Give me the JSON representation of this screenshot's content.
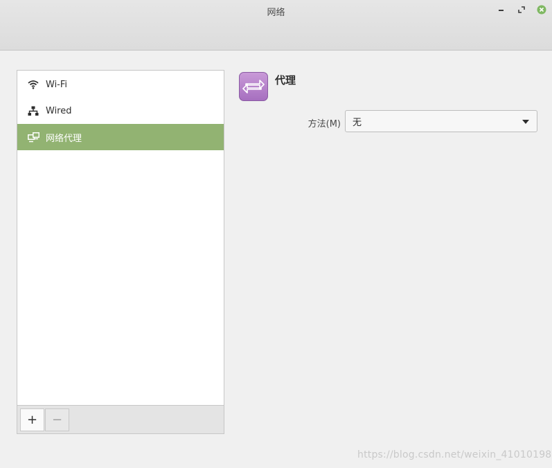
{
  "window": {
    "title": "网络"
  },
  "sidebar": {
    "items": [
      {
        "label": "Wi-Fi",
        "icon": "wifi-icon",
        "selected": false
      },
      {
        "label": "Wired",
        "icon": "wired-network-icon",
        "selected": false
      },
      {
        "label": "网络代理",
        "icon": "network-proxy-icon",
        "selected": true
      }
    ],
    "add_label": "+",
    "remove_label": "−"
  },
  "panel": {
    "title": "代理",
    "icon": "proxy-arrows-icon",
    "method_label": "方法(M)",
    "method_value": "无"
  },
  "watermark": "https://blog.csdn.net/weixin_41010198",
  "colors": {
    "selection": "#92b372",
    "close_button": "#7fb862",
    "proxy_icon": "#b07ec8"
  }
}
